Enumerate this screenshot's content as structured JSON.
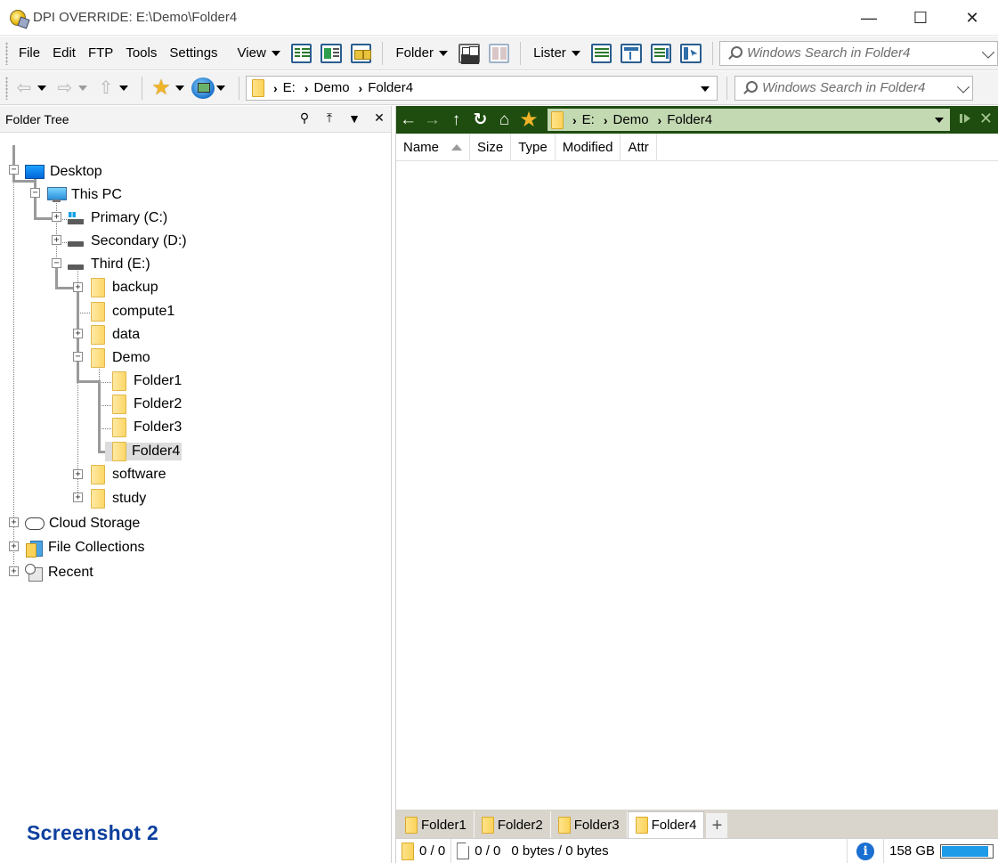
{
  "window": {
    "title": "DPI OVERRIDE: E:\\Demo\\Folder4",
    "controls": {
      "minimize": "—",
      "maximize": "☐",
      "close": "✕"
    }
  },
  "menubar": {
    "items": [
      {
        "label": "File"
      },
      {
        "label": "Edit"
      },
      {
        "label": "FTP"
      },
      {
        "label": "Tools"
      },
      {
        "label": "Settings"
      },
      {
        "label": "View"
      },
      {
        "label": "Folder"
      },
      {
        "label": "Lister"
      }
    ],
    "search_placeholder": "Windows Search in Folder4"
  },
  "navbar": {
    "path": [
      "E:",
      "Demo",
      "Folder4"
    ],
    "search_placeholder": "Windows Search in Folder4"
  },
  "tree": {
    "title": "Folder Tree",
    "nodes": [
      {
        "label": "Desktop"
      },
      {
        "label": "This PC"
      },
      {
        "label": "Primary (C:)"
      },
      {
        "label": "Secondary (D:)"
      },
      {
        "label": "Third (E:)"
      },
      {
        "label": "backup"
      },
      {
        "label": "compute1"
      },
      {
        "label": "data"
      },
      {
        "label": "Demo"
      },
      {
        "label": "Folder1"
      },
      {
        "label": "Folder2"
      },
      {
        "label": "Folder3"
      },
      {
        "label": "Folder4",
        "selected": true
      },
      {
        "label": "software"
      },
      {
        "label": "study"
      },
      {
        "label": "Cloud Storage"
      },
      {
        "label": "File Collections"
      },
      {
        "label": "Recent"
      }
    ]
  },
  "lister": {
    "path": [
      "E:",
      "Demo",
      "Folder4"
    ],
    "columns": [
      "Name",
      "Size",
      "Type",
      "Modified",
      "Attr"
    ],
    "tabs": [
      {
        "label": "Folder1"
      },
      {
        "label": "Folder2"
      },
      {
        "label": "Folder3"
      },
      {
        "label": "Folder4",
        "active": true
      }
    ],
    "tab_add": "+",
    "status": {
      "folders": "0 / 0",
      "files": "0 / 0",
      "bytes": "0 bytes / 0 bytes",
      "free_space": "158 GB",
      "free_fraction": 0.93
    }
  },
  "watermark": "Screenshot 2",
  "colors": {
    "lister_nav_bg": "#1e4d0f",
    "lister_path_bg": "#c3d9b2",
    "folder_yellow": "#fcd766",
    "watermark": "#0d3f9e"
  }
}
